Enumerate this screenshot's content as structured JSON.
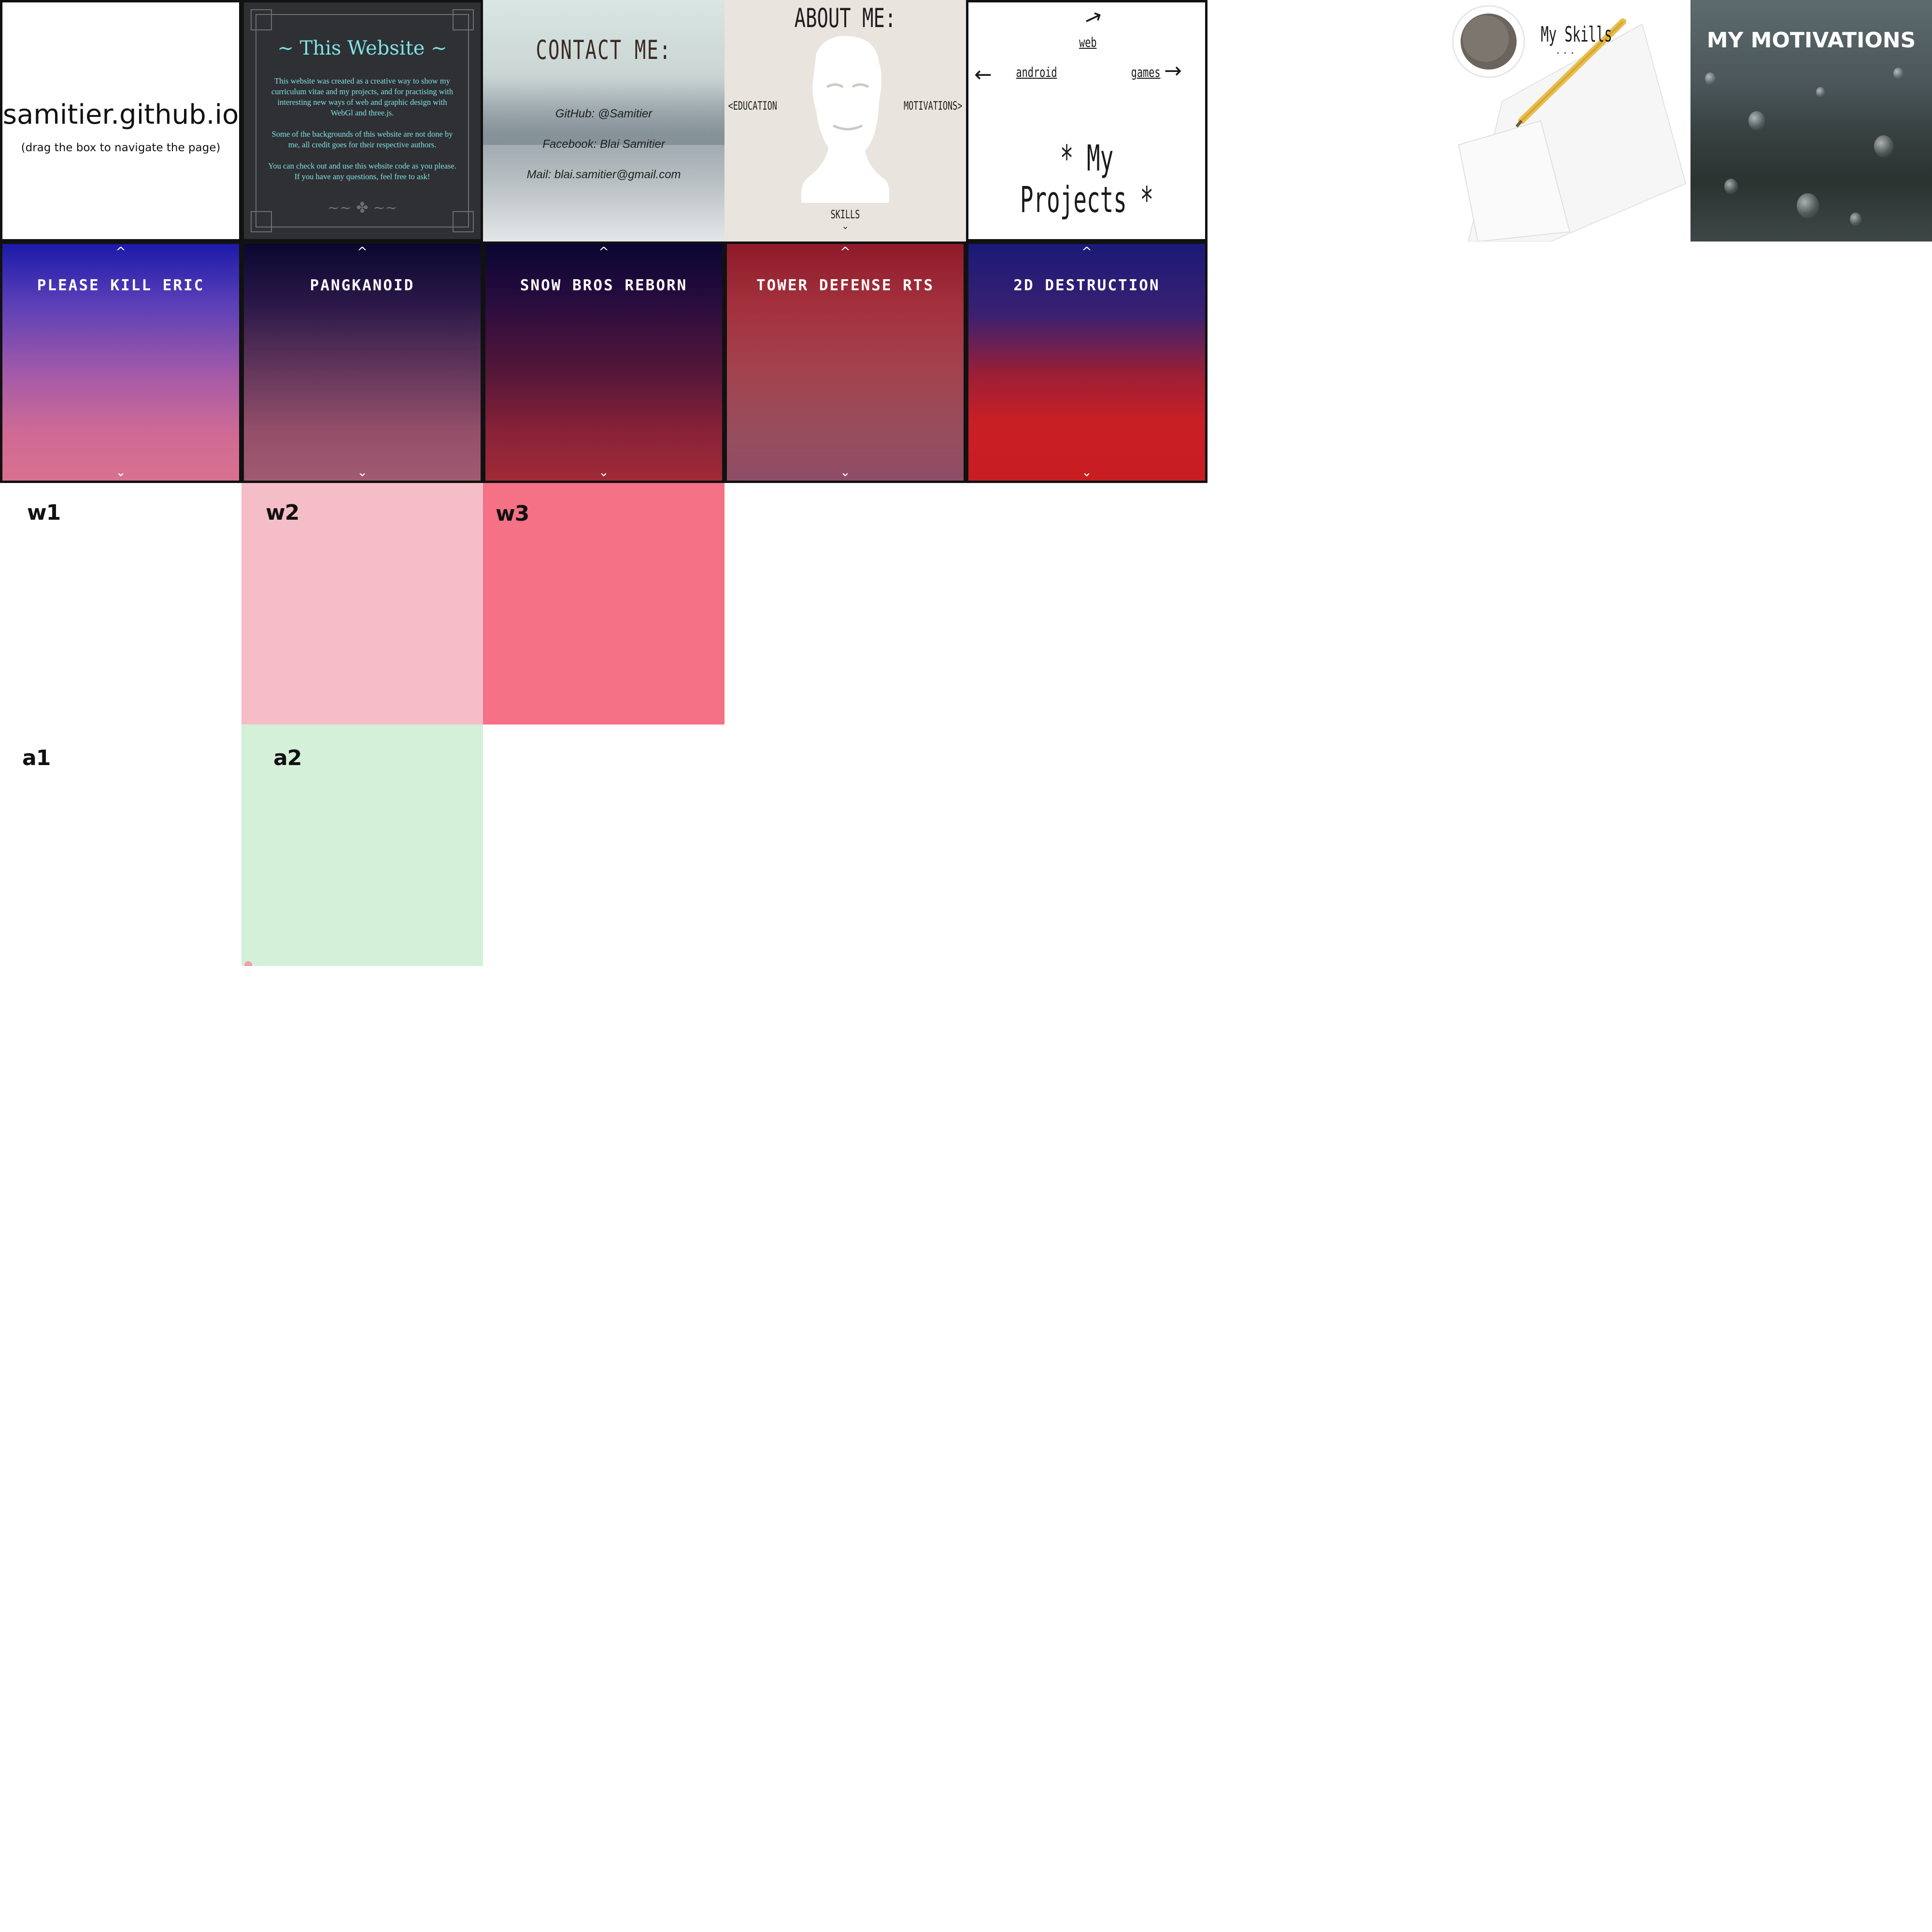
{
  "home": {
    "title": "samitier.github.io",
    "subtitle": "(drag the box to navigate the page)"
  },
  "website": {
    "title": "This Website",
    "paragraphs": [
      "This website was created as a creative way to show my curriculum vitae and my projects, and for practising with interesting new ways of web and graphic design with WebGl and three.js.",
      "Some of the backgrounds of this website are not done by me, all credit goes for their respective authors.",
      "You can check out and use this website code as you please. If you have any questions, feel free to ask!"
    ]
  },
  "contact": {
    "title": "CONTACT ME:",
    "github": "GitHub: @Samitier",
    "facebook": "Facebook: Blai Samitier",
    "mail": "Mail: blai.samitier@gmail.com"
  },
  "about": {
    "title": "ABOUT ME:",
    "left": "<EDUCATION",
    "right": "MOTIVATIONS>",
    "bottom": "SKILLS"
  },
  "projects": {
    "web": "web",
    "android": "android",
    "games": "games",
    "title": "* My Projects *"
  },
  "skills": {
    "title": "My Skills",
    "dots": "..."
  },
  "motivations": {
    "title": "MY MOTIVATIONS"
  },
  "games": [
    {
      "title": "PLEASE KILL ERIC",
      "up": "^",
      "down": "⌄"
    },
    {
      "title": "PANGKANOID",
      "up": "^",
      "down": "⌄"
    },
    {
      "title": "SNOW BROS REBORN",
      "up": "^",
      "down": "⌄"
    },
    {
      "title": "TOWER DEFENSE RTS",
      "up": "^",
      "down": "⌄"
    },
    {
      "title": "2D DESTRUCTION",
      "up": "^",
      "down": "⌄"
    }
  ],
  "web_tiles": [
    {
      "label": "w1",
      "color": "#ffffff"
    },
    {
      "label": "w2",
      "color": "#f4bdc7"
    },
    {
      "label": "w3",
      "color": "#f47186"
    }
  ],
  "android_tiles": [
    {
      "label": "a1",
      "color": "#ffffff"
    },
    {
      "label": "a2",
      "color": "#d4f0d8"
    }
  ]
}
